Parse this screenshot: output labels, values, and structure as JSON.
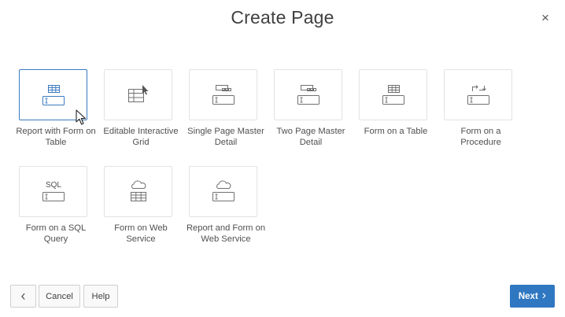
{
  "dialog": {
    "title": "Create Page",
    "close_glyph": "×"
  },
  "tiles": [
    {
      "label": "Report with Form on Table",
      "icon": "report-form-icon"
    },
    {
      "label": "Editable Interactive Grid",
      "icon": "editable-grid-icon"
    },
    {
      "label": "Single Page Master Detail",
      "icon": "single-master-detail-icon"
    },
    {
      "label": "Two Page Master Detail",
      "icon": "two-master-detail-icon"
    },
    {
      "label": "Form on a Table",
      "icon": "form-table-icon"
    },
    {
      "label": "Form on a Procedure",
      "icon": "form-procedure-icon"
    },
    {
      "label": "Form on a SQL Query",
      "icon": "form-sql-icon",
      "icon_text": "SQL"
    },
    {
      "label": "Form on Web Service",
      "icon": "form-web-service-icon"
    },
    {
      "label": "Report and Form on Web Service",
      "icon": "report-form-web-service-icon"
    }
  ],
  "selected_tile": "Report with Form on Table",
  "footer": {
    "back_glyph": "‹",
    "cancel_label": "Cancel",
    "help_label": "Help",
    "next_label": "Next",
    "next_glyph": "›"
  },
  "colors": {
    "accent": "#2f77c1",
    "selected_border": "#3a7bc0",
    "icon_stroke": "#707070"
  }
}
